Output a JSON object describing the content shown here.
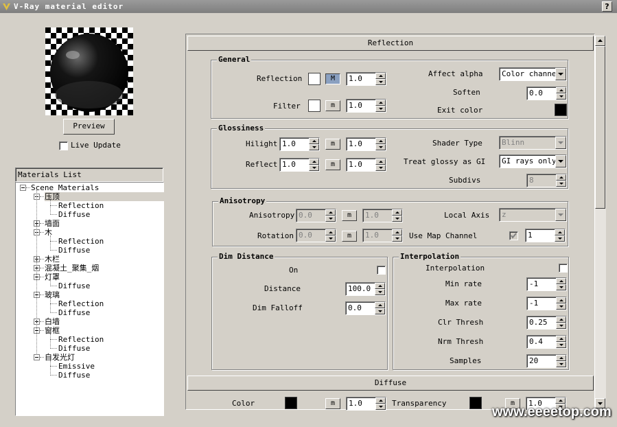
{
  "window": {
    "title": "V-Ray material editor",
    "help": "?"
  },
  "preview": {
    "button": "Preview",
    "live_update": "Live Update"
  },
  "materials": {
    "title": "Materials List",
    "root": "Scene Materials",
    "nodes": [
      {
        "label": "压顶",
        "children": [
          "Reflection",
          "Diffuse"
        ],
        "selected": true,
        "expanded": true
      },
      {
        "label": "墙面",
        "children": [],
        "expanded": false
      },
      {
        "label": "木",
        "children": [
          "Reflection",
          "Diffuse"
        ],
        "expanded": true
      },
      {
        "label": "木栏",
        "children": [],
        "expanded": false
      },
      {
        "label": "混凝土_聚集_烟",
        "children": [],
        "expanded": false
      },
      {
        "label": "灯罩",
        "children": [
          "Diffuse"
        ],
        "expanded": true
      },
      {
        "label": "玻璃",
        "children": [
          "Reflection",
          "Diffuse"
        ],
        "expanded": true
      },
      {
        "label": "白墙",
        "children": [],
        "expanded": false
      },
      {
        "label": "窗框",
        "children": [
          "Reflection",
          "Diffuse"
        ],
        "expanded": true
      },
      {
        "label": "自发光灯",
        "children": [
          "Emissive",
          "Diffuse"
        ],
        "expanded": true
      }
    ]
  },
  "reflection": {
    "header": "Reflection",
    "general": {
      "title": "General",
      "reflection_label": "Reflection",
      "reflection_m": "M",
      "reflection_val": "1.0",
      "filter_label": "Filter",
      "filter_m": "m",
      "filter_val": "1.0",
      "affect_alpha_label": "Affect alpha",
      "affect_alpha_val": "Color channel",
      "soften_label": "Soften",
      "soften_val": "0.0",
      "exit_color_label": "Exit color"
    },
    "glossiness": {
      "title": "Glossiness",
      "hilight_label": "Hilight",
      "hilight_val": "1.0",
      "hilight_m": "m",
      "hilight_val2": "1.0",
      "reflect_label": "Reflect",
      "reflect_val": "1.0",
      "reflect_m": "m",
      "reflect_val2": "1.0",
      "shader_type_label": "Shader Type",
      "shader_type_val": "Blinn",
      "treat_label": "Treat glossy as GI",
      "treat_val": "GI rays only",
      "subdivs_label": "Subdivs",
      "subdivs_val": "8"
    },
    "anisotropy": {
      "title": "Anisotropy",
      "aniso_label": "Anisotropy",
      "aniso_val": "0.0",
      "aniso_m": "m",
      "aniso_val2": "1.0",
      "local_axis_label": "Local Axis",
      "local_axis_val": "z",
      "rotation_label": "Rotation",
      "rotation_val": "0.0",
      "rotation_m": "m",
      "rotation_val2": "1.0",
      "use_map_label": "Use Map Channel",
      "map_channel_val": "1"
    },
    "dim": {
      "title": "Dim Distance",
      "on_label": "On",
      "distance_label": "Distance",
      "distance_val": "100.0",
      "falloff_label": "Dim Falloff",
      "falloff_val": "0.0"
    },
    "interp": {
      "title": "Interpolation",
      "interp_label": "Interpolation",
      "min_label": "Min rate",
      "min_val": "-1",
      "max_label": "Max rate",
      "max_val": "-1",
      "clr_label": "Clr Thresh",
      "clr_val": "0.25",
      "nrm_label": "Nrm Thresh",
      "nrm_val": "0.4",
      "samples_label": "Samples",
      "samples_val": "20"
    }
  },
  "diffuse": {
    "header": "Diffuse",
    "color_label": "Color",
    "color_m": "m",
    "color_val": "1.0",
    "transparency_label": "Transparency",
    "transparency_m": "m",
    "transparency_val": "1.0"
  },
  "watermark": "www.eeeetop.com",
  "colors": {
    "titlebar": "#8a8a8a",
    "face": "#d4d0c8",
    "selected_m": "#8aa0c0",
    "swatch_black": "#000000",
    "swatch_white": "#ffffff"
  }
}
